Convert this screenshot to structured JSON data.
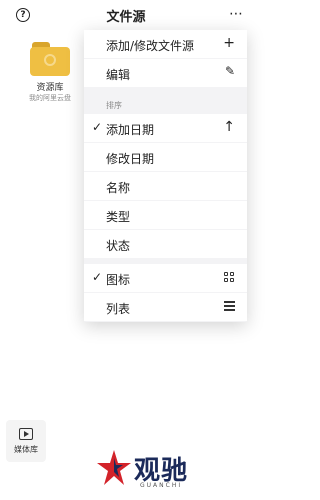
{
  "header": {
    "title": "文件源",
    "help_icon": "?",
    "more_icon": "⋯"
  },
  "grid": {
    "items": [
      {
        "name": "资源库",
        "subtitle": "我的阿里云盘"
      }
    ]
  },
  "menu": {
    "top": [
      {
        "label": "添加/修改文件源",
        "icon": "+"
      },
      {
        "label": "编辑",
        "icon": "✎"
      }
    ],
    "sort_header": "排序",
    "sort": [
      {
        "label": "添加日期",
        "checked": true,
        "icon": "↑"
      },
      {
        "label": "修改日期"
      },
      {
        "label": "名称"
      },
      {
        "label": "类型"
      },
      {
        "label": "状态"
      }
    ],
    "view": [
      {
        "label": "图标",
        "checked": true,
        "icon": "grid-icon"
      },
      {
        "label": "列表",
        "icon": "list-icon"
      }
    ],
    "check_mark": "✓"
  },
  "bottom_tab": {
    "label": "媒体库"
  },
  "watermark": {
    "text": "观驰",
    "sub": "GUANCHI"
  }
}
